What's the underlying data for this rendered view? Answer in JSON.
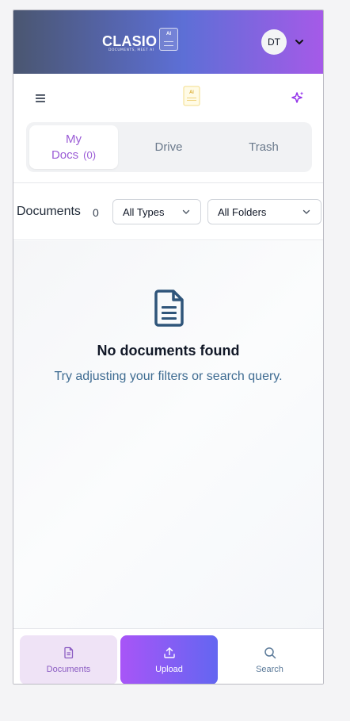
{
  "app": {
    "logo_text": "CLASIO",
    "logo_tagline": "DOCUMENTS, MEET AI",
    "logo_badge": "AI"
  },
  "user": {
    "initials": "DT"
  },
  "toolbar": {
    "menu_icon": "hamburger-menu-icon",
    "center_icon": "ai-document-icon",
    "center_badge": "AI",
    "right_icon": "sparkle-icon"
  },
  "tabs": [
    {
      "label": "My Docs",
      "count": "(0)",
      "active": true
    },
    {
      "label": "Drive",
      "active": false
    },
    {
      "label": "Trash",
      "active": false
    }
  ],
  "filters": {
    "title": "Documents",
    "count": "0",
    "type_select": "All Types",
    "folder_select": "All Folders"
  },
  "empty_state": {
    "icon": "document-icon",
    "title": "No documents found",
    "subtitle": "Try adjusting your filters or search query."
  },
  "bottom_nav": [
    {
      "label": "Documents",
      "icon": "document-icon"
    },
    {
      "label": "Upload",
      "icon": "upload-icon"
    },
    {
      "label": "Search",
      "icon": "search-icon"
    }
  ],
  "colors": {
    "header_gradient_start": "#4a5670",
    "header_gradient_end": "#a55ae8",
    "accent_purple": "#9b5cd6",
    "subtitle_blue": "#3f6c92"
  }
}
